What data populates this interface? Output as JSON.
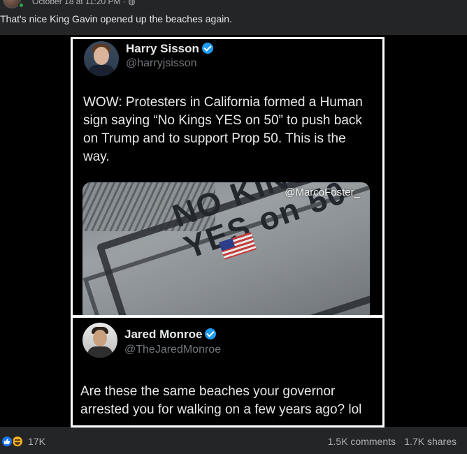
{
  "post": {
    "date": "October 18 at 11:20 PM · ",
    "privacy_icon": "globe-icon",
    "text": "That's nice King Gavin opened up the beaches again."
  },
  "tweet1": {
    "name": "Harry Sisson",
    "handle": "@harryjsisson",
    "body": "WOW: Protesters in California formed a Human sign saying “No Kings YES on 50” to push back on Trump and to support Prop 50. This is the way.",
    "image": {
      "watermark": "@MarcoFoster_",
      "crowd_line1": "NO KINGS",
      "crowd_line2": "YES on 50"
    }
  },
  "tweet2": {
    "name": "Jared Monroe",
    "handle": "@TheJaredMonroe",
    "body": "Are these the same beaches your governor arrested you for walking on a few years ago? lol"
  },
  "stats": {
    "reactions": "17K",
    "comments": "1.5K comments",
    "shares": "1.7K shares"
  },
  "colors": {
    "background": "#242526",
    "verified": "#1d9bf0",
    "like": "#1877f2",
    "online": "#31a24c"
  }
}
